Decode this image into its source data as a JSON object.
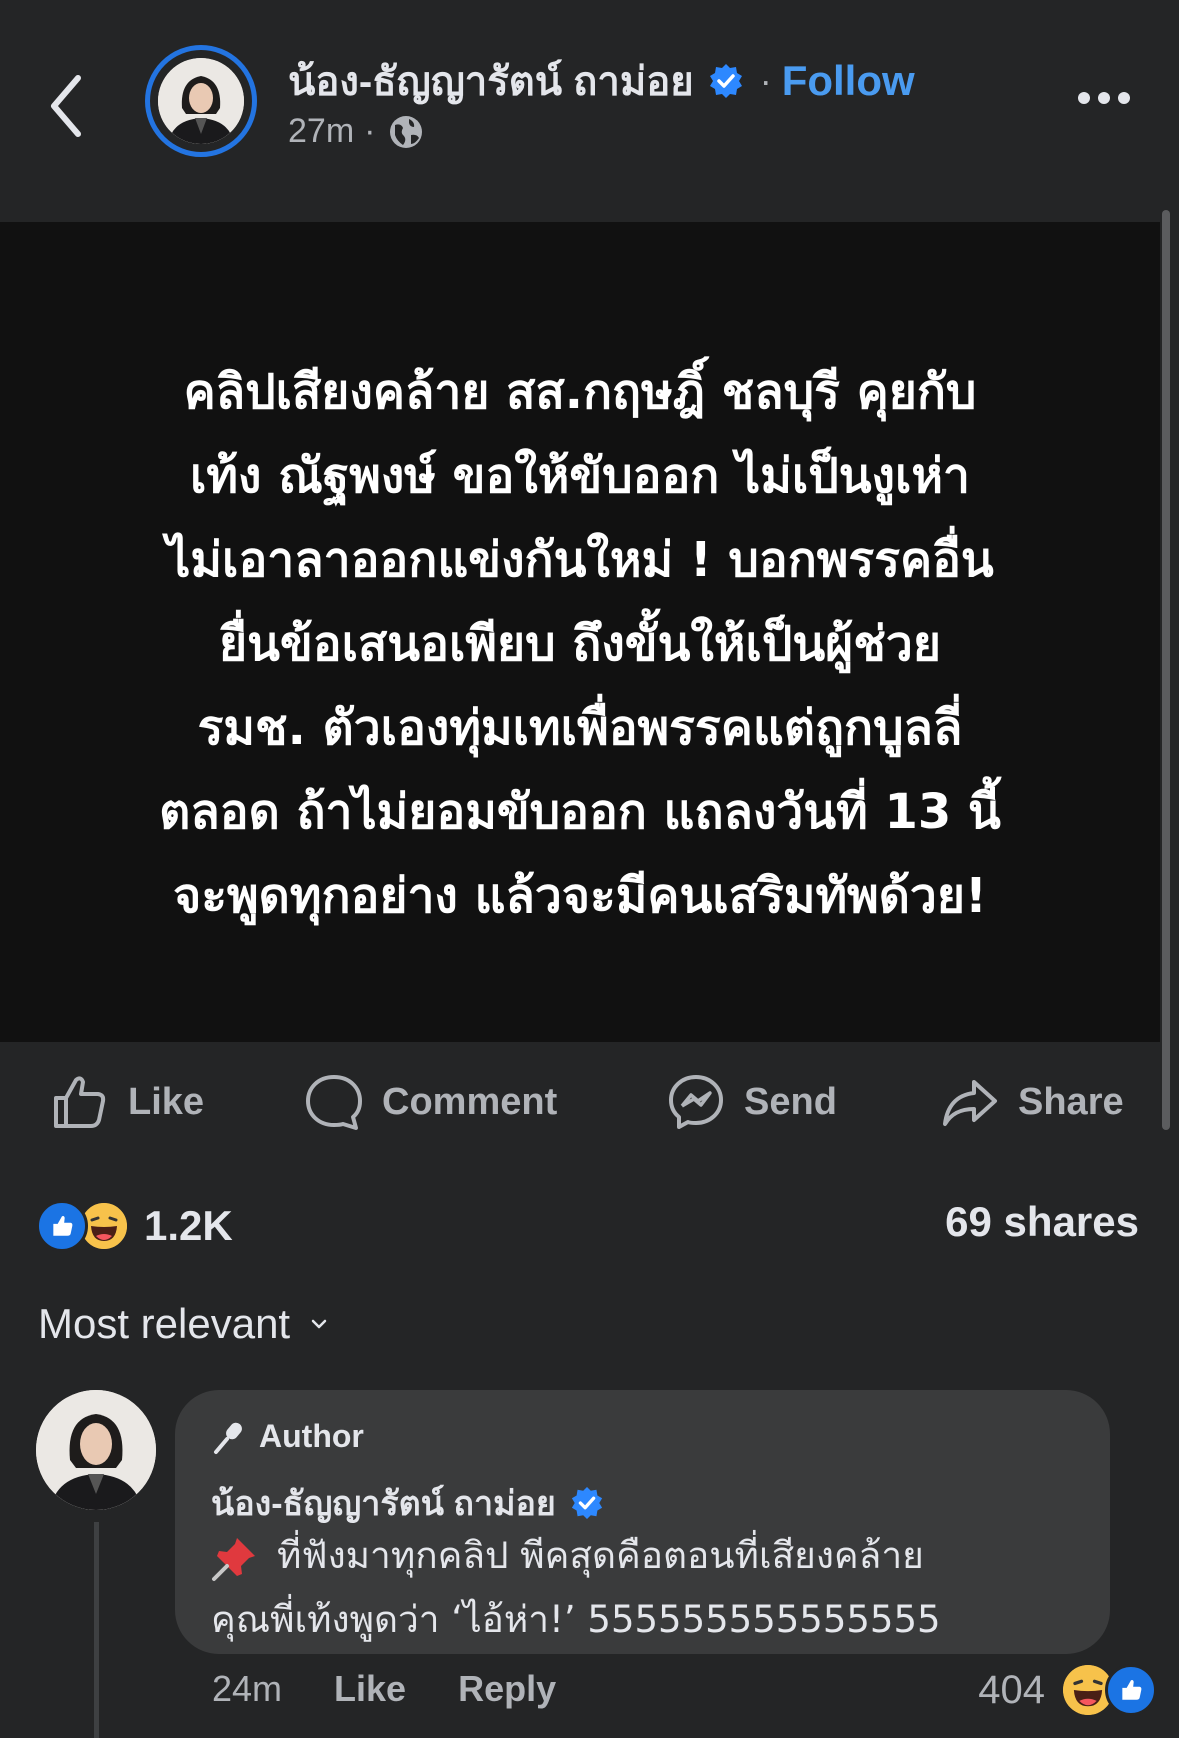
{
  "header": {
    "page_name": "น้อง-ธัญญารัตน์ ถาม่อย",
    "separator": "·",
    "follow_label": "Follow",
    "time": "27m",
    "meta_dot": "·",
    "privacy_icon": "globe-icon"
  },
  "post": {
    "image_text_lines": [
      "คลิปเสียงคล้าย สส.กฤษฎิ์ ชลบุรี คุยกับ",
      "เท้ง ณัฐพงษ์ ขอให้ขับออก ไม่เป็นงูเห่า",
      "ไม่เอาลาออกแข่งกันใหม่ ! บอกพรรคอื่น",
      "ยื่นข้อเสนอเพียบ ถึงขั้นให้เป็นผู้ช่วย",
      "รมช. ตัวเองทุ่มเทเพื่อพรรคแต่ถูกบูลลี่",
      "ตลอด ถ้าไม่ยอมขับออก แถลงวันที่ 13 นี้",
      "จะพูดทุกอย่าง แล้วจะมีคนเสริมทัพด้วย!"
    ]
  },
  "actions": {
    "like": "Like",
    "comment": "Comment",
    "send": "Send",
    "share": "Share"
  },
  "reactions": {
    "count": "1.2K",
    "shares": "69 shares",
    "icons": [
      "like-icon",
      "haha-icon"
    ]
  },
  "sort": {
    "label": "Most relevant"
  },
  "comment": {
    "badge": "Author",
    "name": "น้อง-ธัญญารัตน์ ถาม่อย",
    "line1": "ที่ฟังมาทุกคลิป พีคสุดคือตอนที่เสียงคล้าย",
    "line2": "คุณพี่เท้งพูดว่า ‘ไอ้ห่า!’ 555555555555555",
    "time": "24m",
    "like_label": "Like",
    "reply_label": "Reply",
    "reaction_count": "404"
  },
  "colors": {
    "background": "#242526",
    "accent": "#4a9bf0",
    "like_blue": "#1b74e4",
    "image_bg": "#111111"
  }
}
